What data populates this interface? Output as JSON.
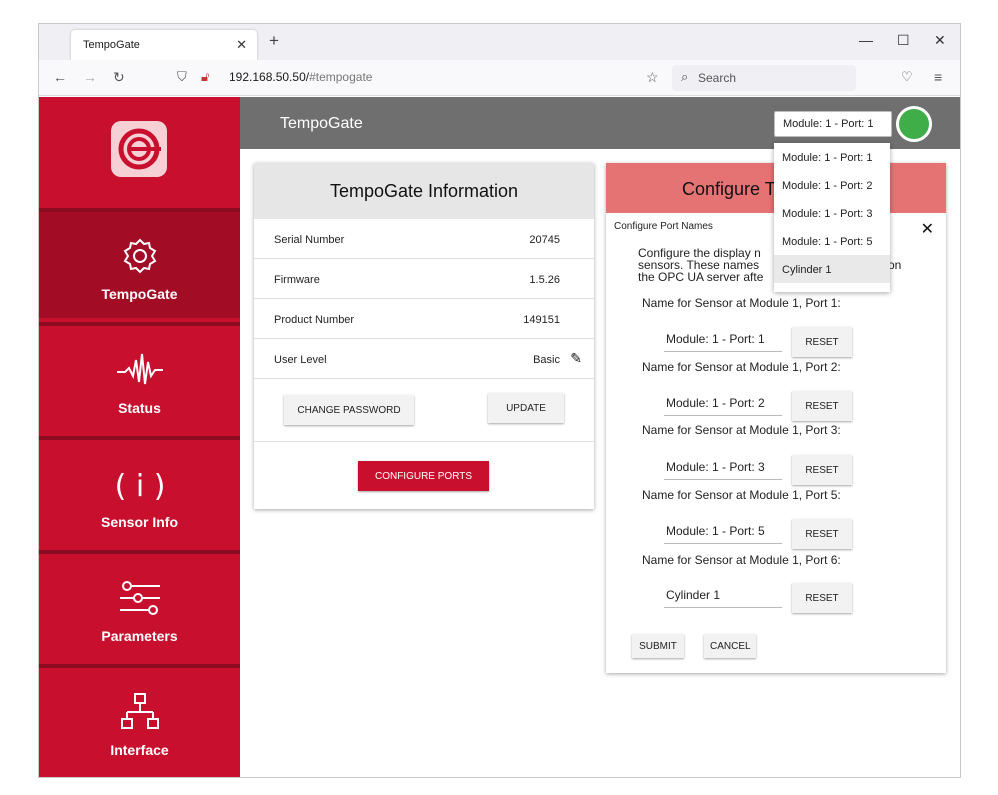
{
  "browser": {
    "tab_title": "TempoGate",
    "url_host": "192.168.50.50/",
    "url_path": "#tempogate",
    "search_placeholder": "Search"
  },
  "sidebar": {
    "items": [
      {
        "label": "TempoGate",
        "icon": "gear-icon",
        "active": true
      },
      {
        "label": "Status",
        "icon": "waveform-icon",
        "active": false
      },
      {
        "label": "Sensor Info",
        "icon": "info-icon",
        "active": false
      },
      {
        "label": "Parameters",
        "icon": "sliders-icon",
        "active": false
      },
      {
        "label": "Interface",
        "icon": "network-icon",
        "active": false
      }
    ]
  },
  "header": {
    "title": "TempoGate",
    "module_select": "Module: 1 - Port: 1",
    "status_color": "#3fae49"
  },
  "dropdown": {
    "options": [
      "Module: 1 - Port: 1",
      "Module: 1 - Port: 2",
      "Module: 1 - Port: 3",
      "Module: 1 - Port: 5",
      "Cylinder 1"
    ]
  },
  "info": {
    "title": "TempoGate Information",
    "rows": [
      {
        "label": "Serial Number",
        "value": "20745"
      },
      {
        "label": "Firmware",
        "value": "1.5.26"
      },
      {
        "label": "Product Number",
        "value": "149151"
      },
      {
        "label": "User Level",
        "value": "Basic"
      }
    ],
    "change_password": "CHANGE PASSWORD",
    "update": "UPDATE",
    "configure_ports": "CONFIGURE PORTS"
  },
  "configure": {
    "title": "Configure T",
    "subtitle": "Configure Port Names",
    "desc_line1": "Configure the display n",
    "desc_line2": "sensors. These names",
    "desc_line2_tail": "on",
    "desc_line3": "the OPC UA server afte",
    "ports": [
      {
        "label": "Name for Sensor at Module 1, Port 1:",
        "value": "Module: 1 - Port: 1"
      },
      {
        "label": "Name for Sensor at Module 1, Port 2:",
        "value": "Module: 1 - Port: 2"
      },
      {
        "label": "Name for Sensor at Module 1, Port 3:",
        "value": "Module: 1 - Port: 3"
      },
      {
        "label": "Name for Sensor at Module 1, Port 5:",
        "value": "Module: 1 - Port: 5"
      },
      {
        "label": "Name for Sensor at Module 1, Port 6:",
        "value": "Cylinder 1"
      }
    ],
    "reset": "RESET",
    "submit": "SUBMIT",
    "cancel": "CANCEL"
  },
  "colors": {
    "brand_red": "#c8102e",
    "header_gray": "#6f6f6f",
    "dialog_head": "#e57373"
  }
}
